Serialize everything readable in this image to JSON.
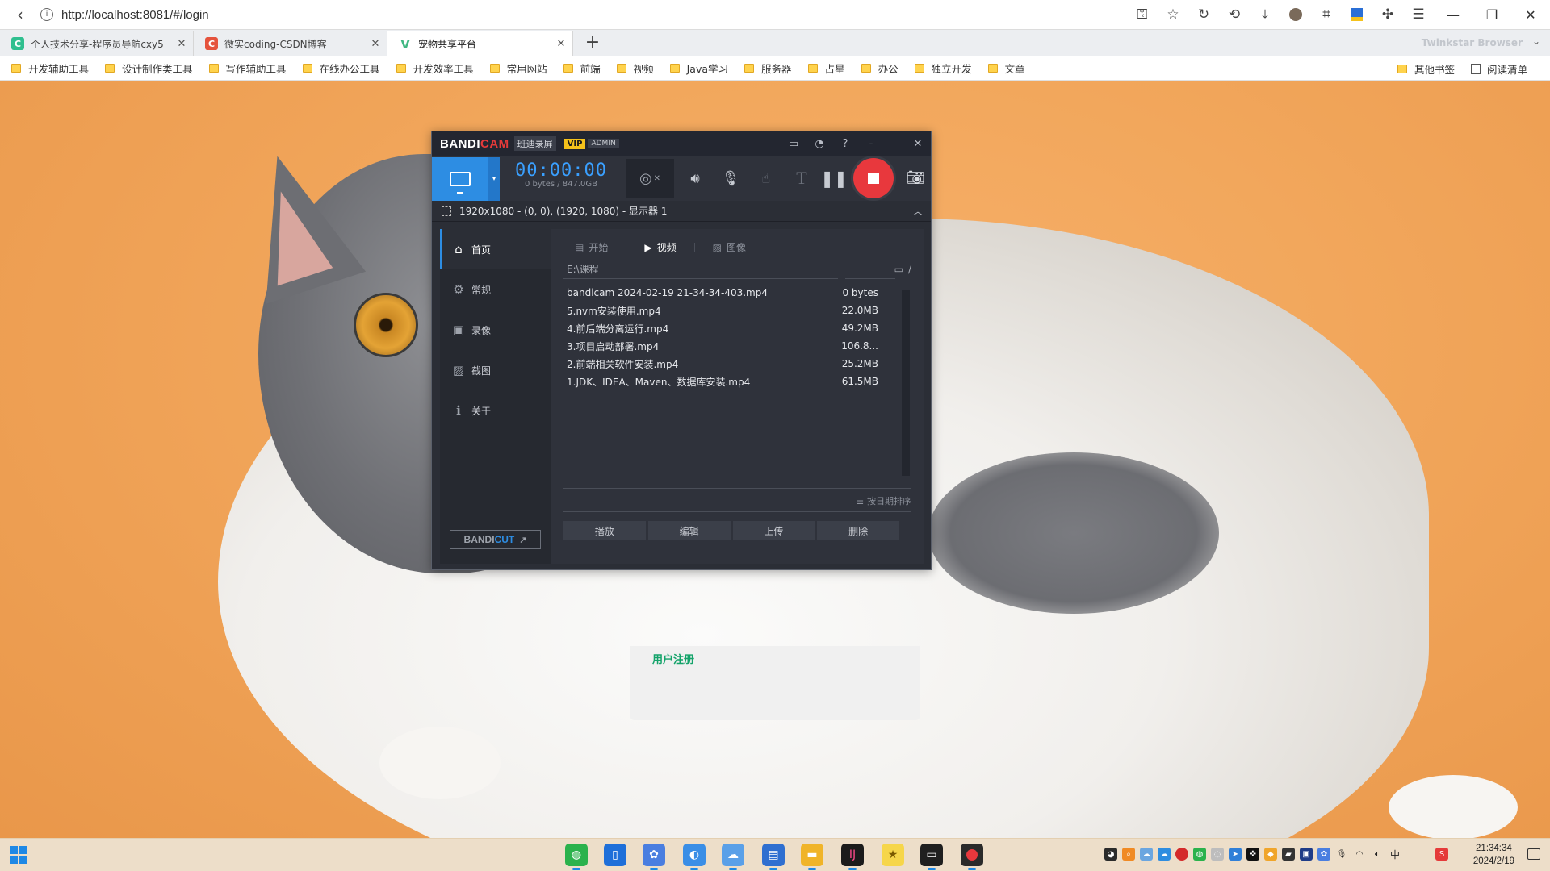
{
  "browser": {
    "url": "http://localhost:8081/#/login",
    "brand": "Twinkstar Browser",
    "tabs": [
      {
        "title": "个人技术分享-程序员导航cxy5",
        "favicon": "C",
        "color": "#2fbf8f"
      },
      {
        "title": "微实coding-CSDN博客",
        "favicon": "C",
        "color": "#e5533d"
      },
      {
        "title": "宠物共享平台",
        "favicon": "V",
        "color": "#41b883"
      }
    ],
    "active_tab": 2,
    "toolbar_icons": [
      "key-icon",
      "star-icon",
      "reload-icon",
      "history-icon",
      "download-icon",
      "avatar-icon",
      "crop-icon",
      "shield-icon",
      "extensions-icon",
      "menu-icon"
    ],
    "bookmarks": [
      "开发辅助工具",
      "设计制作类工具",
      "写作辅助工具",
      "在线办公工具",
      "开发效率工具",
      "常用网站",
      "前端",
      "视频",
      "Java学习",
      "服务器",
      "占星",
      "办公",
      "独立开发",
      "文章"
    ],
    "bookmarks_right": [
      "其他书签",
      "阅读清单"
    ]
  },
  "page": {
    "register_link": "用户注册"
  },
  "bandicam": {
    "logo_a": "BANDI",
    "logo_b": "CAM",
    "cn_name": "班迪录屏",
    "vip": "VIP",
    "admin": "ADMIN",
    "timer": "00:00:00",
    "size": "0 bytes / 847.0GB",
    "region": "1920x1080 - (0, 0), (1920, 1080) - 显示器 1",
    "sidebar": [
      {
        "label": "首页",
        "icon": "home-icon",
        "glyph": "⌂"
      },
      {
        "label": "常规",
        "icon": "gear-icon",
        "glyph": "⚙"
      },
      {
        "label": "录像",
        "icon": "video-settings-icon",
        "glyph": "▣"
      },
      {
        "label": "截图",
        "icon": "image-settings-icon",
        "glyph": "▨"
      },
      {
        "label": "关于",
        "icon": "info-icon",
        "glyph": "ℹ"
      }
    ],
    "bandicut_a": "BANDI",
    "bandicut_b": "CUT",
    "tabs": [
      "开始",
      "视频",
      "图像"
    ],
    "active_tab": 1,
    "path": "E:\\课程",
    "files": [
      {
        "name": "bandicam 2024-02-19 21-34-34-403.mp4",
        "size": "0 bytes"
      },
      {
        "name": "5.nvm安装使用.mp4",
        "size": "22.0MB"
      },
      {
        "name": "4.前后端分离运行.mp4",
        "size": "49.2MB"
      },
      {
        "name": "3.项目启动部署.mp4",
        "size": "106.8..."
      },
      {
        "name": "2.前端相关软件安装.mp4",
        "size": "25.2MB"
      },
      {
        "name": "1.JDK、IDEA、Maven、数据库安装.mp4",
        "size": "61.5MB"
      }
    ],
    "sort_label": "按日期排序",
    "actions": [
      "播放",
      "编辑",
      "上传",
      "删除"
    ],
    "accent": "#2d8de3",
    "record_color": "#e8383d"
  },
  "taskbar": {
    "time": "21:34:34",
    "date": "2024/2/19"
  }
}
